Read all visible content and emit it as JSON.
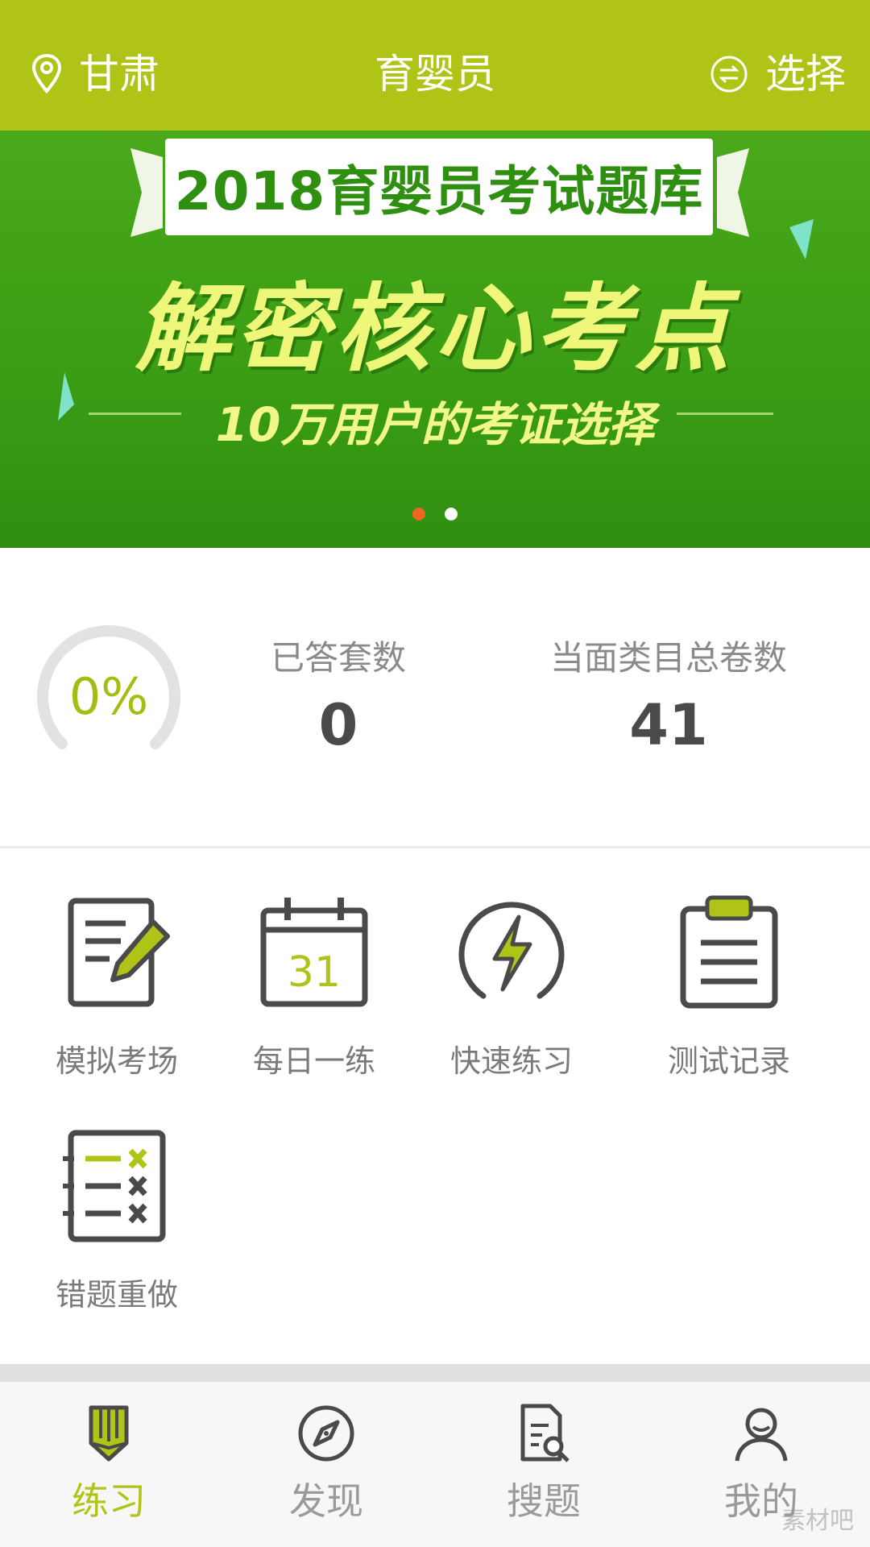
{
  "header": {
    "location": "甘肃",
    "title": "育婴员",
    "select_label": "选择"
  },
  "banner": {
    "ribbon_text": "2018育婴员考试题库",
    "headline": "解密核心考点",
    "subline": "10万用户的考证选择",
    "slides": 2,
    "active_slide": 1,
    "colors": {
      "dot_active": "#f0651f",
      "dot_inactive": "#ffffff"
    }
  },
  "stats": {
    "progress_text": "0%",
    "progress_value": 0,
    "answered_label": "已答套数",
    "answered_value": "0",
    "total_label": "当面类目总卷数",
    "total_value": "41"
  },
  "features": [
    {
      "label": "模拟考场",
      "icon": "exam-paper-pencil-icon"
    },
    {
      "label": "每日一练",
      "icon": "calendar-icon"
    },
    {
      "label": "快速练习",
      "icon": "lightning-icon"
    },
    {
      "label": "测试记录",
      "icon": "clipboard-icon"
    },
    {
      "label": "错题重做",
      "icon": "wrong-list-icon"
    }
  ],
  "calendar_day": "31",
  "nav": [
    {
      "label": "练习",
      "icon": "pencil-icon",
      "active": true
    },
    {
      "label": "发现",
      "icon": "compass-icon",
      "active": false
    },
    {
      "label": "搜题",
      "icon": "search-document-icon",
      "active": false
    },
    {
      "label": "我的",
      "icon": "user-icon",
      "active": false
    }
  ],
  "watermark": "素材吧",
  "colors": {
    "accent": "#afc417",
    "accent_text": "#a4bd10",
    "icon_dark": "#4a4a4a"
  }
}
